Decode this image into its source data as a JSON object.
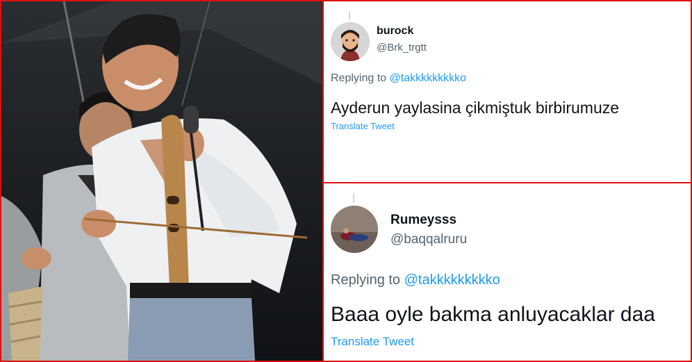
{
  "tweets": [
    {
      "display_name": "burock",
      "handle": "@Brk_trgtt",
      "replying_prefix": "Replying to",
      "replying_to": "@takkkkkkkkko",
      "text": "Ayderun yaylasina çikmiştuk birbirumuze",
      "translate_label": "Translate Tweet"
    },
    {
      "display_name": "Rumeysss",
      "handle": "@baqqalruru",
      "replying_prefix": "Replying to",
      "replying_to": "@takkkkkkkkko",
      "text": "Baaa oyle bakma anluyacaklar daa",
      "translate_label": "Translate Tweet"
    }
  ],
  "colors": {
    "border": "#e01010",
    "link": "#1d9bf0",
    "secondary_text": "#536471",
    "primary_text": "#0f1419"
  },
  "icons": [
    "cartoon-avatar-icon",
    "photo-avatar-icon"
  ]
}
